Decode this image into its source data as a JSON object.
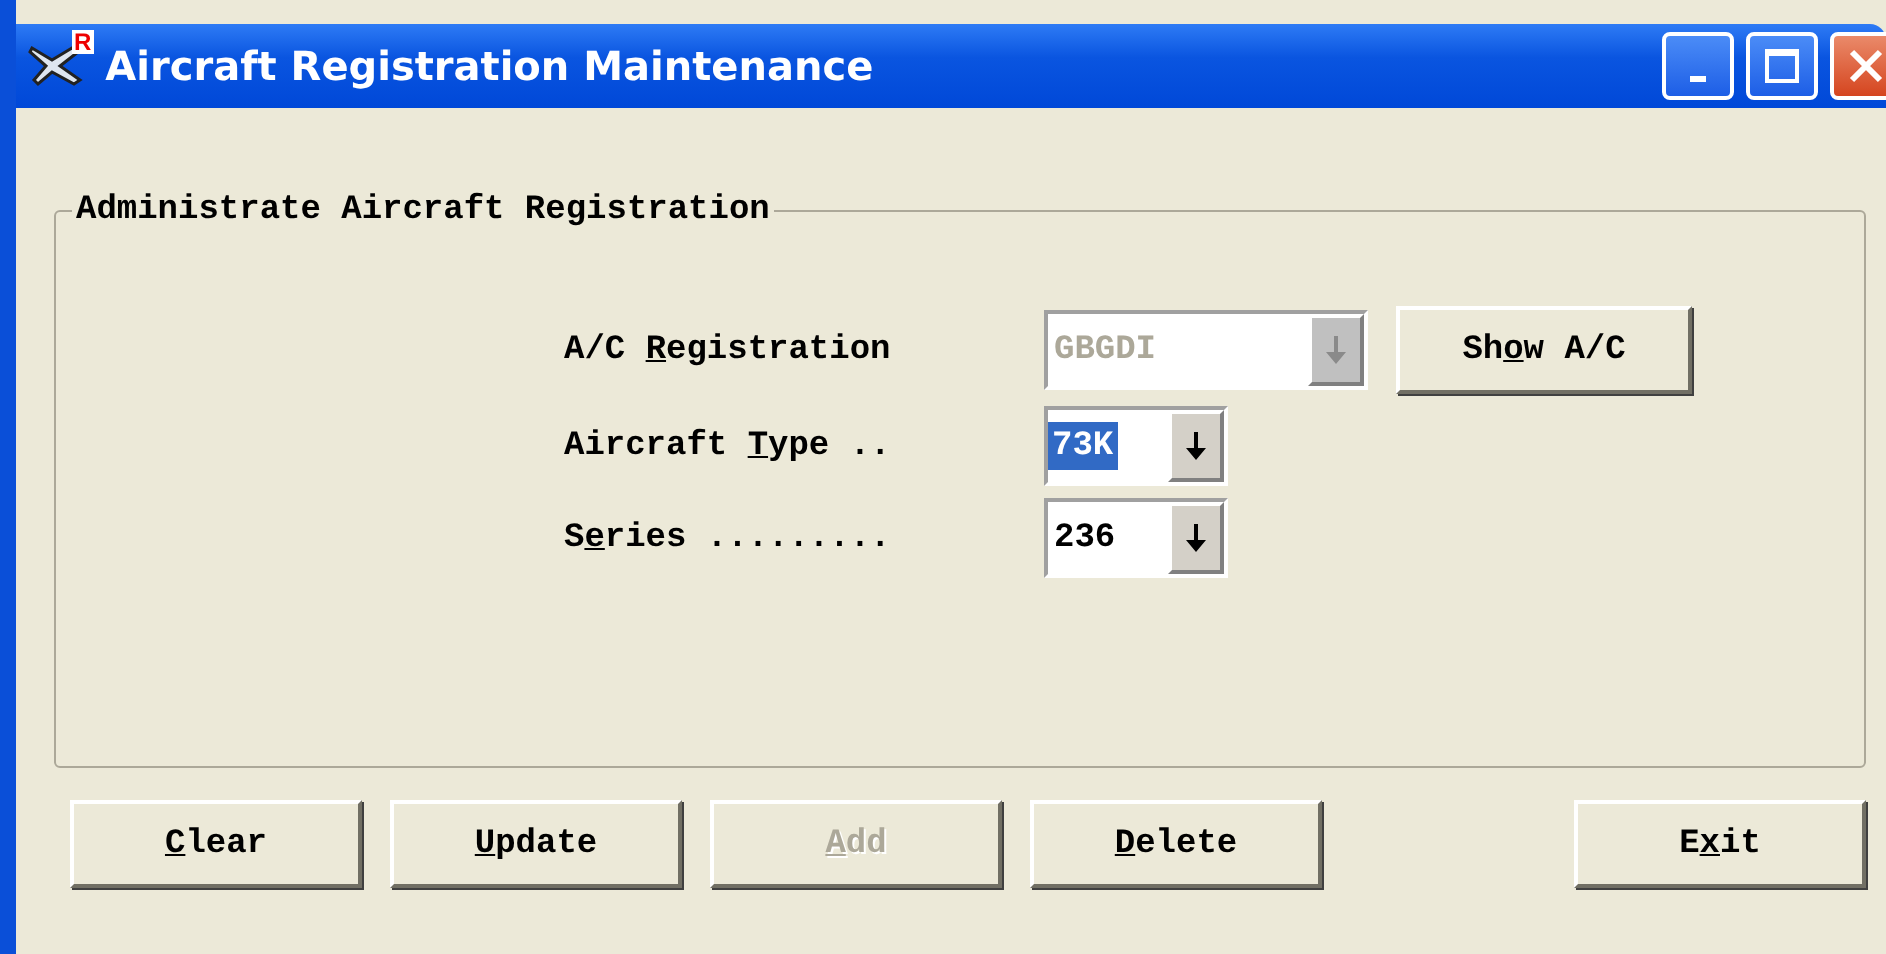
{
  "window": {
    "title": "Aircraft Registration Maintenance",
    "icon_badge": "R"
  },
  "group": {
    "title": "Administrate Aircraft Registration"
  },
  "fields": [
    {
      "label_before": "A/C ",
      "access_key": "R",
      "label_after": "egistration",
      "value": "GBGDI",
      "disabled": true,
      "value_selected": false,
      "wide": true
    },
    {
      "label_before": "Aircraft ",
      "access_key": "T",
      "label_after": "ype ..",
      "value": "73K",
      "disabled": false,
      "value_selected": true,
      "wide": false
    },
    {
      "label_before": "S",
      "access_key": "e",
      "label_after": "ries .........",
      "value": "236",
      "disabled": false,
      "value_selected": false,
      "wide": false
    }
  ],
  "side_button": {
    "label_before": "Sh",
    "access_key": "o",
    "label_after": "w A/C",
    "disabled": false
  },
  "buttons": [
    {
      "access_key": "C",
      "label_after": "lear",
      "disabled": false
    },
    {
      "access_key": "U",
      "label_after": "pdate",
      "disabled": false
    },
    {
      "access_key": "A",
      "label_after": "dd",
      "disabled": true
    },
    {
      "access_key": "D",
      "label_after": "elete",
      "disabled": false
    },
    {
      "label_before": "E",
      "access_key": "x",
      "label_after": "it",
      "disabled": false
    }
  ]
}
